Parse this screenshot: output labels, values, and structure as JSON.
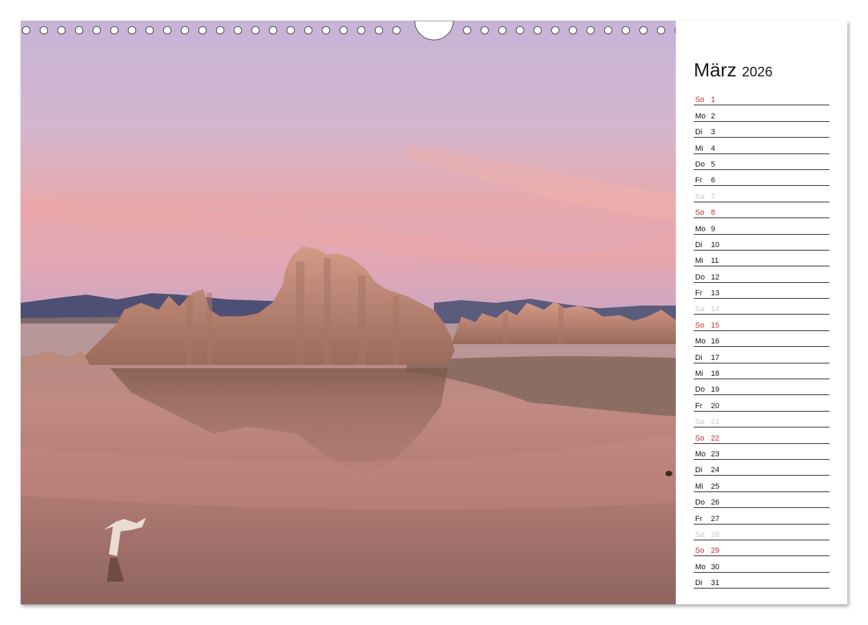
{
  "calendar": {
    "month": "März",
    "year": "2026",
    "days": [
      {
        "wd": "So",
        "d": "1",
        "type": "sunday"
      },
      {
        "wd": "Mo",
        "d": "2",
        "type": "weekday"
      },
      {
        "wd": "Di",
        "d": "3",
        "type": "weekday"
      },
      {
        "wd": "Mi",
        "d": "4",
        "type": "weekday"
      },
      {
        "wd": "Do",
        "d": "5",
        "type": "weekday"
      },
      {
        "wd": "Fr",
        "d": "6",
        "type": "weekday"
      },
      {
        "wd": "Sa",
        "d": "7",
        "type": "saturday"
      },
      {
        "wd": "So",
        "d": "8",
        "type": "sunday"
      },
      {
        "wd": "Mo",
        "d": "9",
        "type": "weekday"
      },
      {
        "wd": "Di",
        "d": "10",
        "type": "weekday"
      },
      {
        "wd": "Mi",
        "d": "11",
        "type": "weekday"
      },
      {
        "wd": "Do",
        "d": "12",
        "type": "weekday"
      },
      {
        "wd": "Fr",
        "d": "13",
        "type": "weekday"
      },
      {
        "wd": "Sa",
        "d": "14",
        "type": "saturday"
      },
      {
        "wd": "So",
        "d": "15",
        "type": "sunday"
      },
      {
        "wd": "Mo",
        "d": "16",
        "type": "weekday"
      },
      {
        "wd": "Di",
        "d": "17",
        "type": "weekday"
      },
      {
        "wd": "Mi",
        "d": "18",
        "type": "weekday"
      },
      {
        "wd": "Do",
        "d": "19",
        "type": "weekday"
      },
      {
        "wd": "Fr",
        "d": "20",
        "type": "weekday"
      },
      {
        "wd": "Sa",
        "d": "21",
        "type": "saturday"
      },
      {
        "wd": "So",
        "d": "22",
        "type": "sunday"
      },
      {
        "wd": "Mo",
        "d": "23",
        "type": "weekday"
      },
      {
        "wd": "Di",
        "d": "24",
        "type": "weekday"
      },
      {
        "wd": "Mi",
        "d": "25",
        "type": "weekday"
      },
      {
        "wd": "Do",
        "d": "26",
        "type": "weekday"
      },
      {
        "wd": "Fr",
        "d": "27",
        "type": "weekday"
      },
      {
        "wd": "Sa",
        "d": "28",
        "type": "saturday"
      },
      {
        "wd": "So",
        "d": "29",
        "type": "sunday"
      },
      {
        "wd": "Mo",
        "d": "30",
        "type": "weekday"
      },
      {
        "wd": "Di",
        "d": "31",
        "type": "weekday"
      }
    ]
  },
  "colors": {
    "sunday": "#c8282a",
    "saturday": "#c9c9c9",
    "weekday": "#111111"
  },
  "photo": {
    "subject": "tufa-towers-lake-sunset-icon"
  }
}
